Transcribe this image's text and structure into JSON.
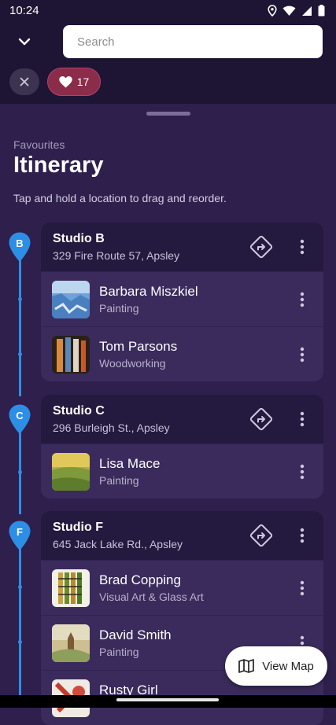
{
  "status_bar": {
    "time": "10:24",
    "icons": [
      "location-icon",
      "wifi-icon",
      "signal-icon",
      "battery-icon"
    ]
  },
  "header": {
    "back_icon": "chevron-down-icon",
    "search_placeholder": "Search",
    "clear_icon": "close-icon",
    "favourites_count": "17",
    "favourites_icon": "heart-icon"
  },
  "sheet": {
    "eyebrow": "Favourites",
    "title": "Itinerary",
    "hint": "Tap and hold a location to drag and reorder."
  },
  "colors": {
    "accent_blue": "#2d8ee6",
    "background": "#2e1f4d",
    "card": "#3a2b5c",
    "card_header": "#24193e",
    "favourites_chip": "#8a2c4a"
  },
  "stops": [
    {
      "marker": "B",
      "name": "Studio B",
      "address": "329 Fire Route 57, Apsley",
      "artists": [
        {
          "name": "Barbara Miszkiel",
          "category": "Painting"
        },
        {
          "name": "Tom Parsons",
          "category": "Woodworking"
        }
      ]
    },
    {
      "marker": "C",
      "name": "Studio C",
      "address": "296 Burleigh St., Apsley",
      "artists": [
        {
          "name": "Lisa Mace",
          "category": "Painting"
        }
      ]
    },
    {
      "marker": "F",
      "name": "Studio F",
      "address": "645 Jack Lake Rd., Apsley",
      "artists": [
        {
          "name": "Brad Copping",
          "category": "Visual Art & Glass Art"
        },
        {
          "name": "David Smith",
          "category": "Painting"
        },
        {
          "name": "Rusty Girl",
          "category": ""
        }
      ]
    }
  ],
  "view_map": {
    "label": "View Map",
    "icon": "map-icon"
  }
}
